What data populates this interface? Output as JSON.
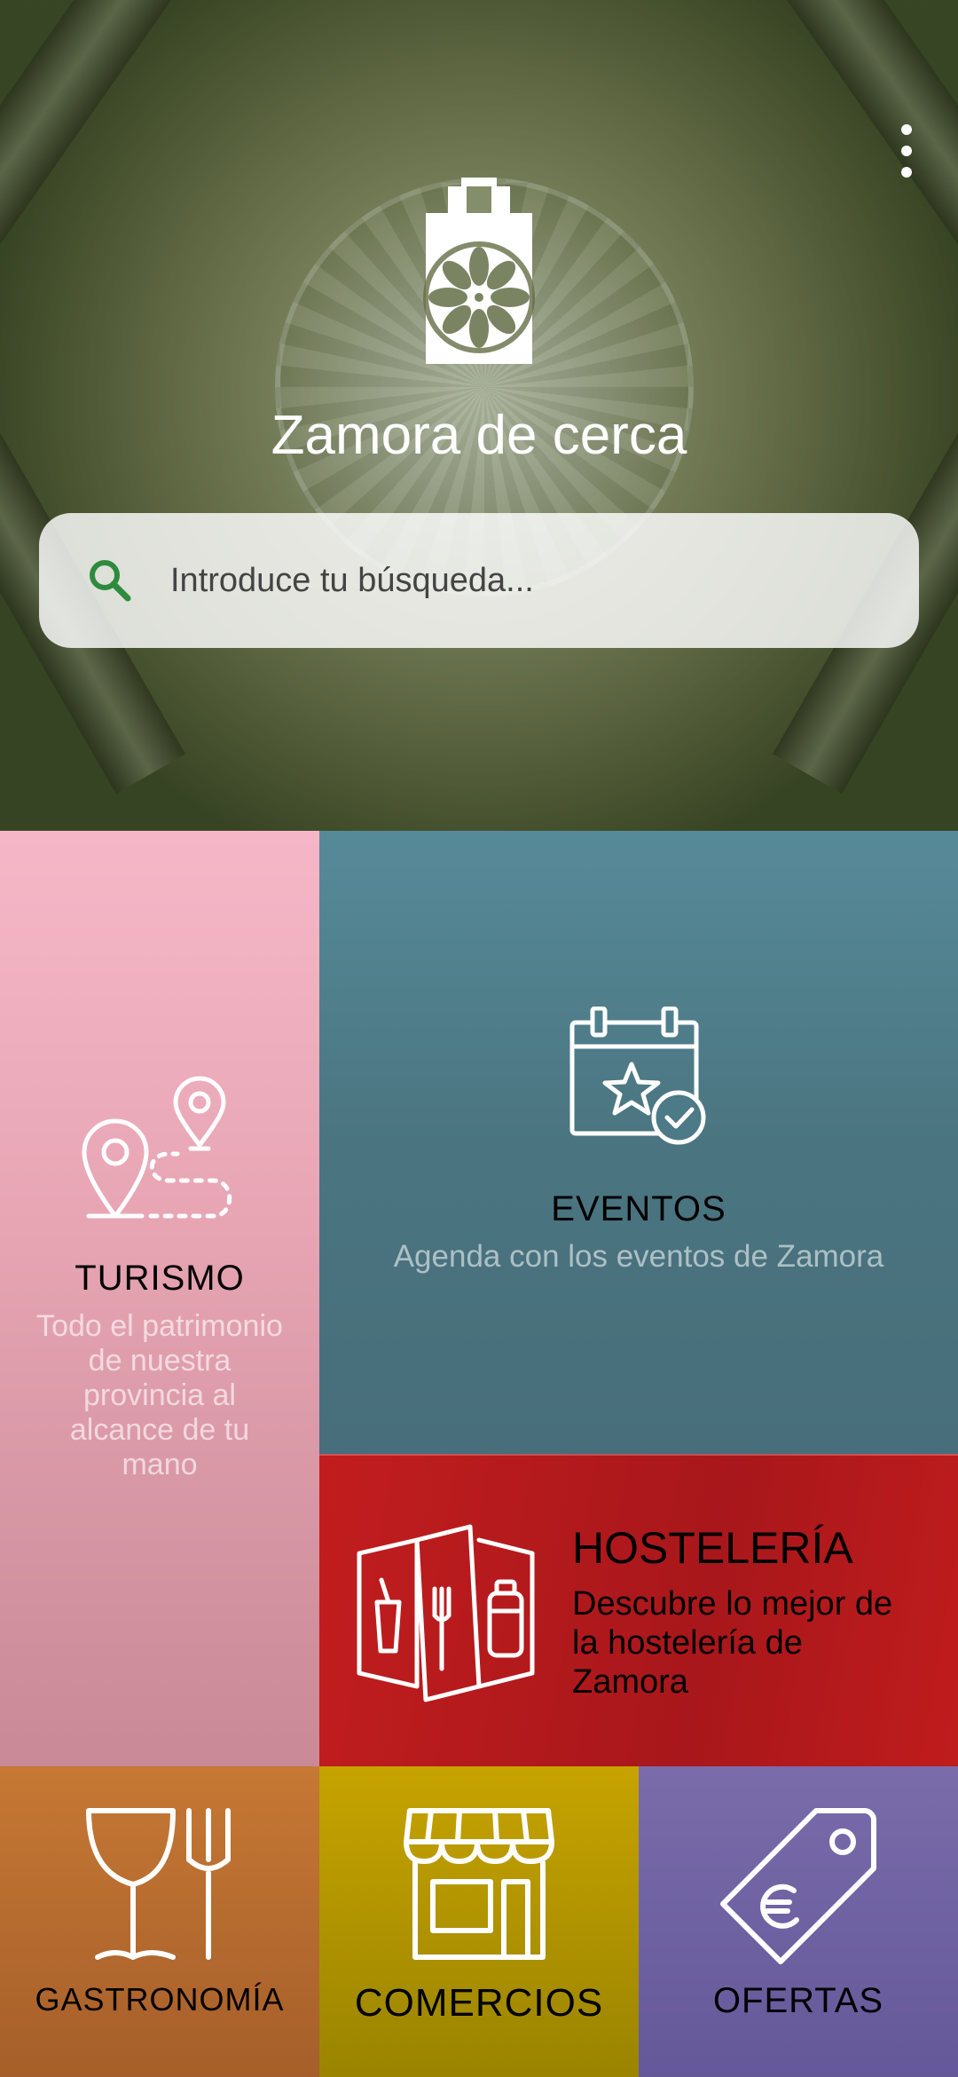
{
  "app": {
    "title": "Zamora de cerca"
  },
  "search": {
    "placeholder": "Introduce tu búsqueda..."
  },
  "tiles": {
    "turismo": {
      "title": "TURISMO",
      "description": "Todo el patrimonio de nuestra provincia al alcance de tu mano",
      "color": "#e8a6b5"
    },
    "eventos": {
      "title": "EVENTOS",
      "description": "Agenda con los eventos de Zamora",
      "color": "#4a7580"
    },
    "hosteleria": {
      "title": "HOSTELERÍA",
      "description": "Descubre lo mejor de la hostelería de Zamora",
      "color": "#b71a1d"
    },
    "gastronomia": {
      "title": "GASTRONOMÍA",
      "color": "#b56a2f"
    },
    "comercios": {
      "title": "COMERCIOS",
      "color": "#b39400"
    },
    "ofertas": {
      "title": "OFERTAS",
      "color": "#6f62a2"
    }
  },
  "icons": {
    "menu": "more-vert-icon",
    "logo": "rose-window-logo",
    "search": "search-icon",
    "turismo": "route-pins-icon",
    "eventos": "calendar-star-icon",
    "hosteleria": "menu-folder-icon",
    "gastronomia": "glass-fork-icon",
    "comercios": "storefront-icon",
    "ofertas": "price-tag-euro-icon"
  }
}
